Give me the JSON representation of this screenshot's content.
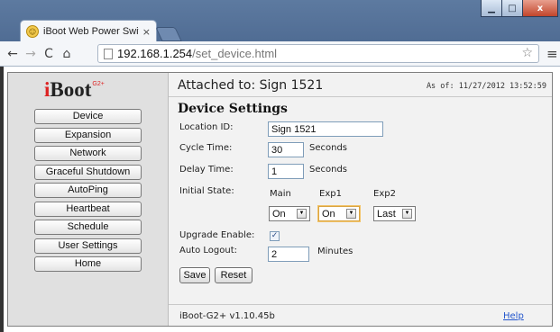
{
  "browser": {
    "tab_title": "iBoot Web Power Switch",
    "tab_close": "×",
    "url_host": "192.168.1.254",
    "url_path": "/set_device.html",
    "icons": [
      "back-icon",
      "forward-icon",
      "reload-icon",
      "home-icon",
      "page-icon",
      "star-icon",
      "menu-icon"
    ],
    "window_buttons": {
      "minimize": "▁",
      "maximize": "□",
      "close": "x"
    }
  },
  "logo": {
    "brand_i": "i",
    "brand_rest": "Boot",
    "superscript": "G2+"
  },
  "sidebar": {
    "items": [
      {
        "label": "Device"
      },
      {
        "label": "Expansion"
      },
      {
        "label": "Network"
      },
      {
        "label": "Graceful Shutdown"
      },
      {
        "label": "AutoPing"
      },
      {
        "label": "Heartbeat"
      },
      {
        "label": "Schedule"
      },
      {
        "label": "User Settings"
      },
      {
        "label": "Home"
      }
    ]
  },
  "header": {
    "attached": "Attached to: Sign 1521",
    "as_of": "As of: 11/27/2012 13:52:59"
  },
  "form": {
    "title": "Device Settings",
    "location_id": {
      "label": "Location ID:",
      "value": "Sign 1521"
    },
    "cycle_time": {
      "label": "Cycle Time:",
      "value": "30",
      "unit": "Seconds"
    },
    "delay_time": {
      "label": "Delay Time:",
      "value": "1",
      "unit": "Seconds"
    },
    "initial_state": {
      "label": "Initial State:",
      "columns": [
        {
          "header": "Main",
          "value": "On"
        },
        {
          "header": "Exp1",
          "value": "On"
        },
        {
          "header": "Exp2",
          "value": "Last"
        }
      ]
    },
    "upgrade_enable": {
      "label": "Upgrade Enable:",
      "checked": true,
      "mark": "✓"
    },
    "auto_logout": {
      "label": "Auto Logout:",
      "value": "2",
      "unit": "Minutes"
    },
    "save_label": "Save",
    "reset_label": "Reset"
  },
  "footer": {
    "version": "iBoot-G2+ v1.10.45b",
    "help": "Help"
  },
  "colors": {
    "accent_red": "#dd2222",
    "link": "#2255cc",
    "focus": "#d9a441"
  }
}
